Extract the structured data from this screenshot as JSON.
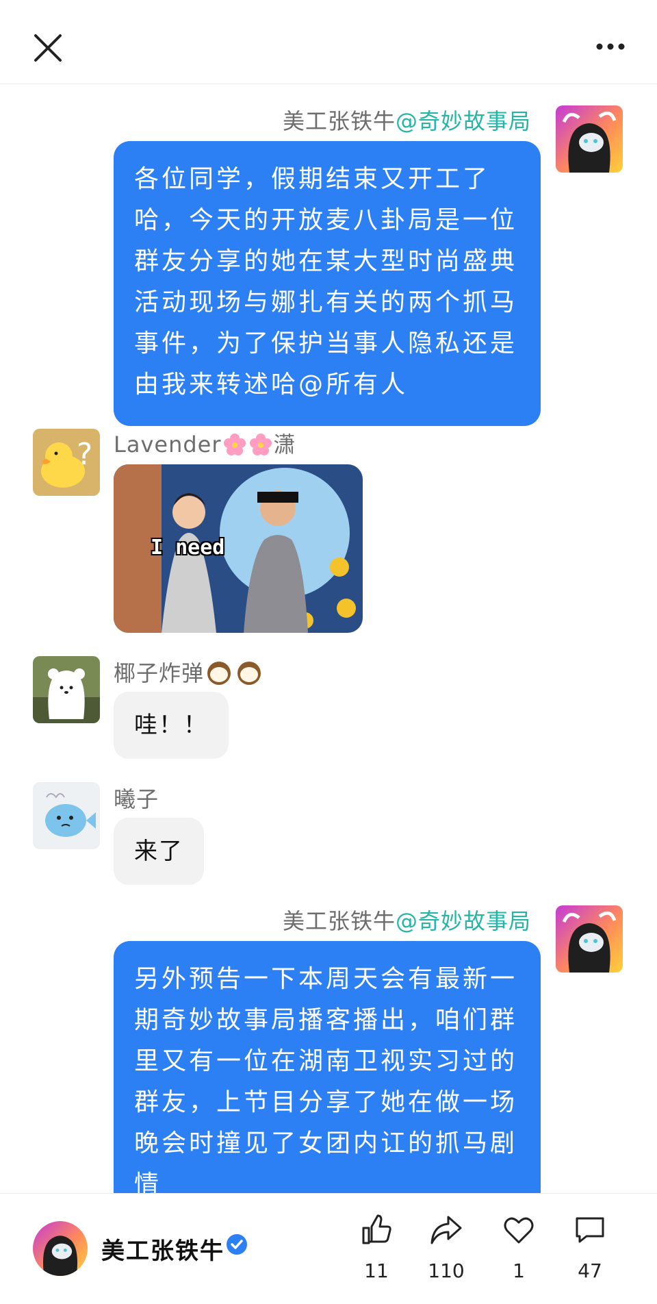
{
  "header": {
    "close_icon": "close-icon",
    "more_icon": "more-icon"
  },
  "messages": [
    {
      "sender": "美工张铁牛",
      "tag": "@奇妙故事局",
      "side": "right",
      "lines": [
        "各位同学，假期结束又开工了",
        "哈，今天的开放麦八卦局是一位",
        "群友分享的她在某大型时尚盛典",
        "活动现场与娜扎有关的两个抓马",
        "事件，为了保护当事人隐私还是",
        "由我来转述哈@所有人"
      ]
    },
    {
      "sender": "Lavender",
      "sender_suffix": "潇",
      "side": "left",
      "image_caption": "I need"
    },
    {
      "sender": "椰子炸弹",
      "side": "left",
      "text": "哇！！"
    },
    {
      "sender": "曦子",
      "side": "left",
      "text": "来了"
    },
    {
      "sender": "美工张铁牛",
      "tag": "@奇妙故事局",
      "side": "right",
      "lines": [
        "另外预告一下本周天会有最新一",
        "期奇妙故事局播客播出，咱们群",
        "里又有一位在湖南卫视实习过的",
        "群友，上节目分享了她在做一场",
        "晚会时撞见了女团内讧的抓马剧",
        "情"
      ]
    }
  ],
  "footer": {
    "author": "美工张铁牛",
    "verified_icon": "verified-icon",
    "actions": [
      {
        "icon": "thumbs-up-icon",
        "count": "11"
      },
      {
        "icon": "share-icon",
        "count": "110"
      },
      {
        "icon": "heart-icon",
        "count": "1"
      },
      {
        "icon": "comment-icon",
        "count": "47"
      }
    ]
  },
  "colors": {
    "bubble_blue": "#2d80f4",
    "tag_teal": "#26b5a4",
    "bubble_gray": "#f2f2f2"
  }
}
